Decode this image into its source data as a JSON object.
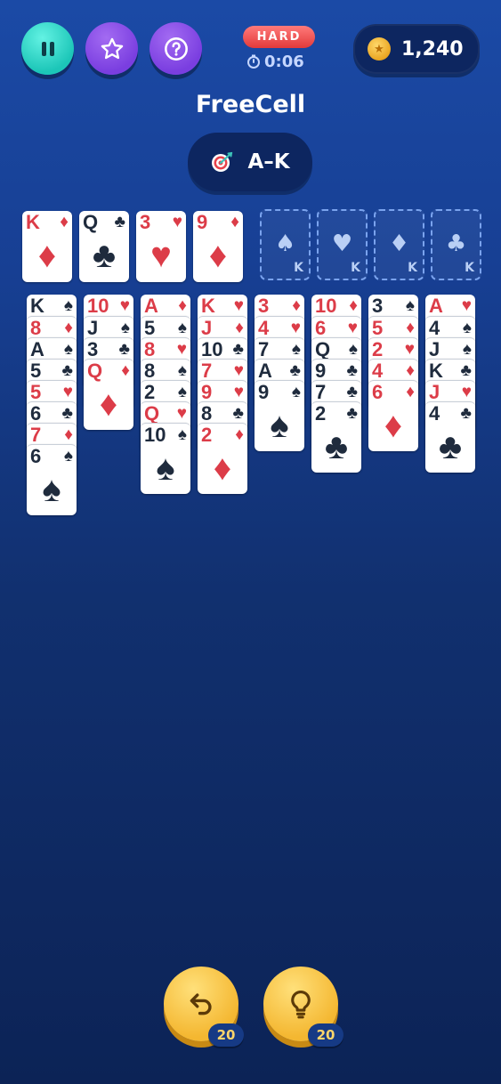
{
  "header": {
    "pause_icon": "pause-icon",
    "star_icon": "star-icon",
    "help_icon": "question-icon",
    "difficulty": "HARD",
    "timer": "0:06",
    "coins": "1,240"
  },
  "title": "FreeCell",
  "mode": {
    "icon": "target-icon",
    "label": "A–K"
  },
  "free_cells": [
    {
      "rank": "K",
      "suit": "♦",
      "color": "red"
    },
    {
      "rank": "Q",
      "suit": "♣",
      "color": "black"
    },
    {
      "rank": "3",
      "suit": "♥",
      "color": "red"
    },
    {
      "rank": "9",
      "suit": "♦",
      "color": "red"
    }
  ],
  "foundations": [
    {
      "suit": "♠",
      "label": "K"
    },
    {
      "suit": "♥",
      "label": "K"
    },
    {
      "suit": "♦",
      "label": "K"
    },
    {
      "suit": "♣",
      "label": "K"
    }
  ],
  "tableau": [
    [
      {
        "rank": "K",
        "suit": "♠",
        "color": "black"
      },
      {
        "rank": "8",
        "suit": "♦",
        "color": "red"
      },
      {
        "rank": "A",
        "suit": "♠",
        "color": "black"
      },
      {
        "rank": "5",
        "suit": "♣",
        "color": "black"
      },
      {
        "rank": "5",
        "suit": "♥",
        "color": "red"
      },
      {
        "rank": "6",
        "suit": "♣",
        "color": "black"
      },
      {
        "rank": "7",
        "suit": "♦",
        "color": "red"
      },
      {
        "rank": "6",
        "suit": "♠",
        "color": "black"
      }
    ],
    [
      {
        "rank": "10",
        "suit": "♥",
        "color": "red"
      },
      {
        "rank": "J",
        "suit": "♠",
        "color": "black"
      },
      {
        "rank": "3",
        "suit": "♣",
        "color": "black"
      },
      {
        "rank": "Q",
        "suit": "♦",
        "color": "red"
      }
    ],
    [
      {
        "rank": "A",
        "suit": "♦",
        "color": "red"
      },
      {
        "rank": "5",
        "suit": "♠",
        "color": "black"
      },
      {
        "rank": "8",
        "suit": "♥",
        "color": "red"
      },
      {
        "rank": "8",
        "suit": "♠",
        "color": "black"
      },
      {
        "rank": "2",
        "suit": "♠",
        "color": "black"
      },
      {
        "rank": "Q",
        "suit": "♥",
        "color": "red"
      },
      {
        "rank": "10",
        "suit": "♠",
        "color": "black"
      }
    ],
    [
      {
        "rank": "K",
        "suit": "♥",
        "color": "red"
      },
      {
        "rank": "J",
        "suit": "♦",
        "color": "red"
      },
      {
        "rank": "10",
        "suit": "♣",
        "color": "black"
      },
      {
        "rank": "7",
        "suit": "♥",
        "color": "red"
      },
      {
        "rank": "9",
        "suit": "♥",
        "color": "red"
      },
      {
        "rank": "8",
        "suit": "♣",
        "color": "black"
      },
      {
        "rank": "2",
        "suit": "♦",
        "color": "red"
      }
    ],
    [
      {
        "rank": "3",
        "suit": "♦",
        "color": "red"
      },
      {
        "rank": "4",
        "suit": "♥",
        "color": "red"
      },
      {
        "rank": "7",
        "suit": "♠",
        "color": "black"
      },
      {
        "rank": "A",
        "suit": "♣",
        "color": "black"
      },
      {
        "rank": "9",
        "suit": "♠",
        "color": "black"
      }
    ],
    [
      {
        "rank": "10",
        "suit": "♦",
        "color": "red"
      },
      {
        "rank": "6",
        "suit": "♥",
        "color": "red"
      },
      {
        "rank": "Q",
        "suit": "♠",
        "color": "black"
      },
      {
        "rank": "9",
        "suit": "♣",
        "color": "black"
      },
      {
        "rank": "7",
        "suit": "♣",
        "color": "black"
      },
      {
        "rank": "2",
        "suit": "♣",
        "color": "black"
      }
    ],
    [
      {
        "rank": "3",
        "suit": "♠",
        "color": "black"
      },
      {
        "rank": "5",
        "suit": "♦",
        "color": "red"
      },
      {
        "rank": "2",
        "suit": "♥",
        "color": "red"
      },
      {
        "rank": "4",
        "suit": "♦",
        "color": "red"
      },
      {
        "rank": "6",
        "suit": "♦",
        "color": "red"
      }
    ],
    [
      {
        "rank": "A",
        "suit": "♥",
        "color": "red"
      },
      {
        "rank": "4",
        "suit": "♠",
        "color": "black"
      },
      {
        "rank": "J",
        "suit": "♠",
        "color": "black"
      },
      {
        "rank": "K",
        "suit": "♣",
        "color": "black"
      },
      {
        "rank": "J",
        "suit": "♥",
        "color": "red"
      },
      {
        "rank": "4",
        "suit": "♣",
        "color": "black"
      }
    ]
  ],
  "bottom": {
    "undo_icon": "undo-icon",
    "undo_count": "20",
    "hint_icon": "lightbulb-icon",
    "hint_count": "20"
  },
  "colors": {
    "red_suit": "#dc3c48",
    "black_suit": "#1f2b3d",
    "pause_button": "#1cc6b8",
    "purple_button": "#7a3ee0",
    "gold_button": "#f4b731"
  }
}
